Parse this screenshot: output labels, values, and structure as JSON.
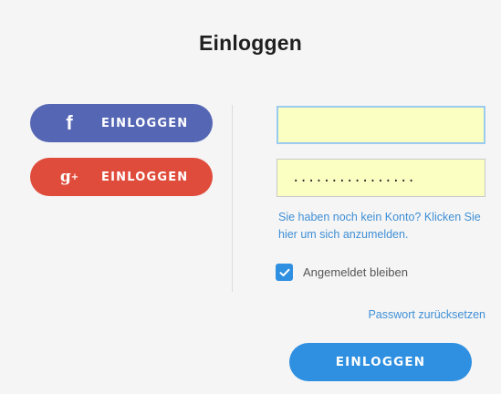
{
  "title": "Einloggen",
  "social": {
    "facebook": {
      "label": "EINLOGGEN",
      "icon": "facebook-icon",
      "color": "#5566b4"
    },
    "google": {
      "label": "EINLOGGEN",
      "icon": "google-plus-icon",
      "color": "#e04c3b"
    }
  },
  "form": {
    "email_value": "",
    "password_value": "................",
    "signup_text": "Sie haben noch kein Konto? Klicken Sie hier um sich anzumelden.",
    "remember_label": "Angemeldet bleiben",
    "remember_checked": true,
    "reset_link": "Passwort zurücksetzen",
    "submit_label": "EINLOGGEN"
  },
  "colors": {
    "accent": "#2f8fe0",
    "link": "#3f8fd6",
    "autofill": "#fbffc2"
  }
}
